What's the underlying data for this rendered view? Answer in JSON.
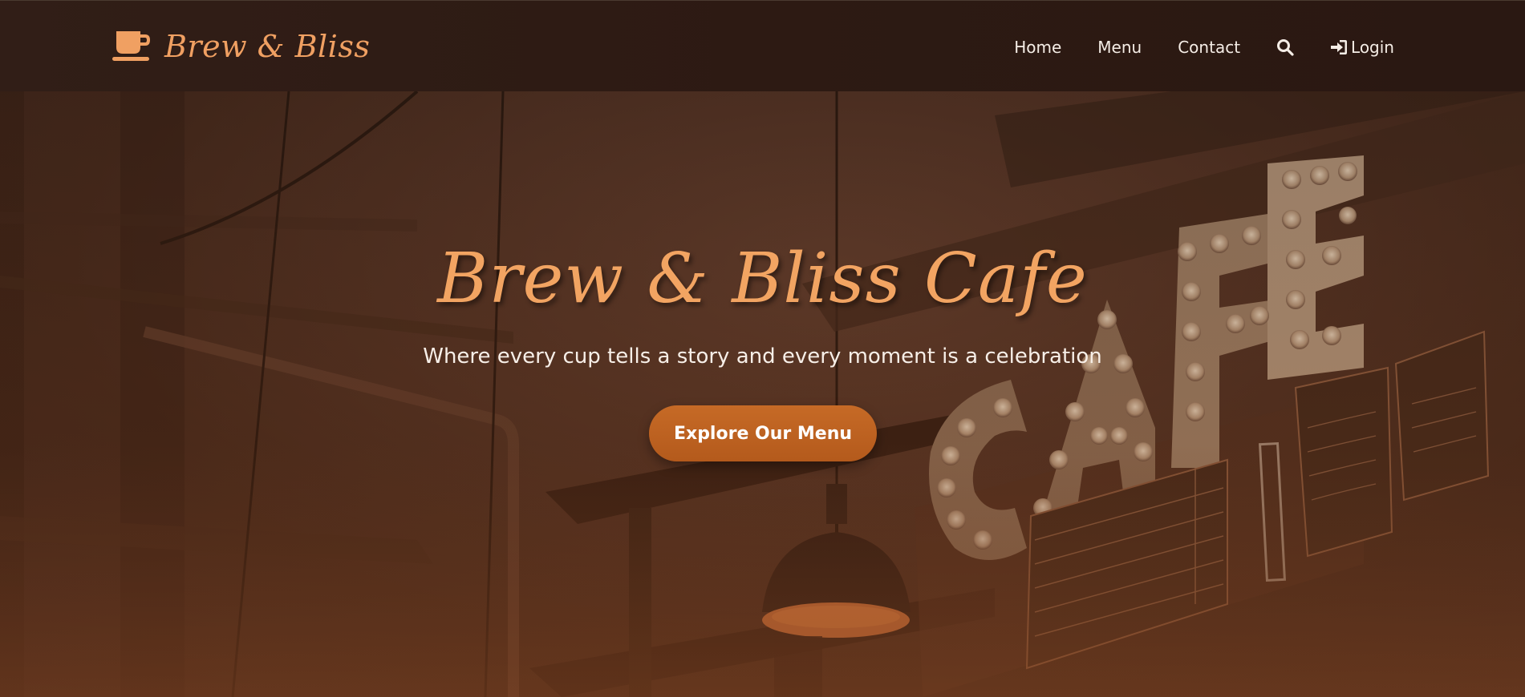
{
  "brand": {
    "name": "Brew & Bliss",
    "icon": "coffee-cup-icon",
    "color": "#f0a062"
  },
  "nav": {
    "items": [
      {
        "label": "Home"
      },
      {
        "label": "Menu"
      },
      {
        "label": "Contact"
      }
    ],
    "search_icon": "search-icon",
    "login": {
      "label": "Login",
      "icon": "sign-in-icon"
    }
  },
  "hero": {
    "title": "Brew & Bliss Cafe",
    "subtitle": "Where every cup tells a story and every moment is a celebration",
    "cta_label": "Explore Our Menu",
    "accent_color": "#c66a26"
  }
}
